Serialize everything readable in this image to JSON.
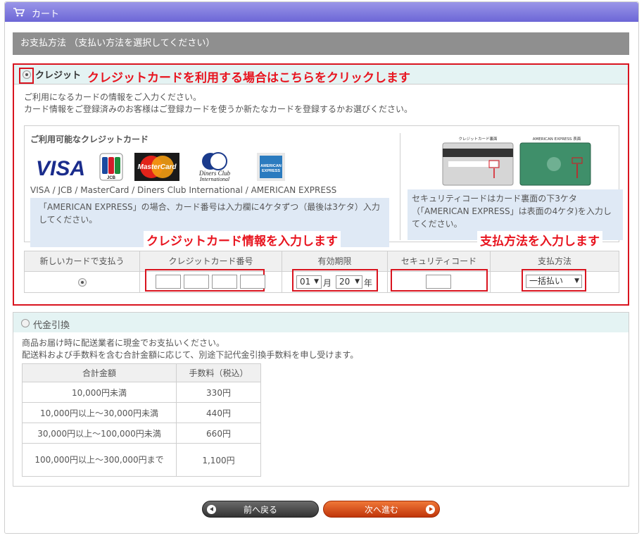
{
  "header": {
    "title": "カート",
    "icon": "cart-icon"
  },
  "section": {
    "title": "お支払方法 （支払い方法を選択してください）"
  },
  "credit": {
    "label": "クレジット",
    "annotation_top": "クレジットカードを利用する場合はこちらをクリックします",
    "intro_line1": "ご利用になるカードの情報をご入力ください。",
    "intro_line2": "カード情報をご登録済みのお客様はご登録カードを使うか新たなカードを登録するかお選びください。",
    "available_title": "ご利用可能なクレジットカード",
    "logos": {
      "visa": "VISA",
      "jcb": "JCB",
      "mastercard": "MasterCard",
      "diners": "Diners Club International",
      "amex": "AMERICAN EXPRESS"
    },
    "card_list": "VISA / JCB / MasterCard / Diners Club International / AMERICAN EXPRESS",
    "amex_note": "「AMERICAN EXPRESS」の場合、カード番号は入力欄に4ケタずつ（最後は3ケタ）入力してください。",
    "security_images": {
      "back_label": "クレジットカード裏面",
      "amex_label": "AMERICAN EXPRESS 表面"
    },
    "security_note": "セキュリティコードはカード裏面の下3ケタ（「AMERICAN EXPRESS」は表面の4ケタ)を入力してください。",
    "annotation_card_info": "クレジットカード情報を入力します",
    "annotation_payment": "支払方法を入力します",
    "table": {
      "headers": {
        "new_card": "新しいカードで支払う",
        "card_number": "クレジットカード番号",
        "expiry": "有効期限",
        "security_code": "セキュリティコード",
        "payment_method": "支払方法"
      },
      "expiry_month": "01",
      "month_unit": "月",
      "expiry_year": "20",
      "year_unit": "年",
      "payment_value": "一括払い"
    }
  },
  "cod": {
    "label": "代金引換",
    "desc_line1": "商品お届け時に配送業者に現金でお支払いください。",
    "desc_line2": "配送料および手数料を含む合計金額に応じて、別途下記代金引換手数料を申し受けます。",
    "headers": {
      "total": "合計金額",
      "fee": "手数料（税込）"
    },
    "rows": [
      {
        "total": "10,000円未満",
        "fee": "330円"
      },
      {
        "total": "10,000円以上～30,000円未満",
        "fee": "440円"
      },
      {
        "total": "30,000円以上～100,000円未満",
        "fee": "660円"
      },
      {
        "total": "100,000円以上～300,000円まで",
        "fee": "1,100円"
      }
    ]
  },
  "buttons": {
    "back": "前へ戻る",
    "next": "次へ進む"
  },
  "colors": {
    "accent_red": "#d9141f",
    "header_purple": "#6c66d6",
    "next_orange": "#e05a1e"
  }
}
